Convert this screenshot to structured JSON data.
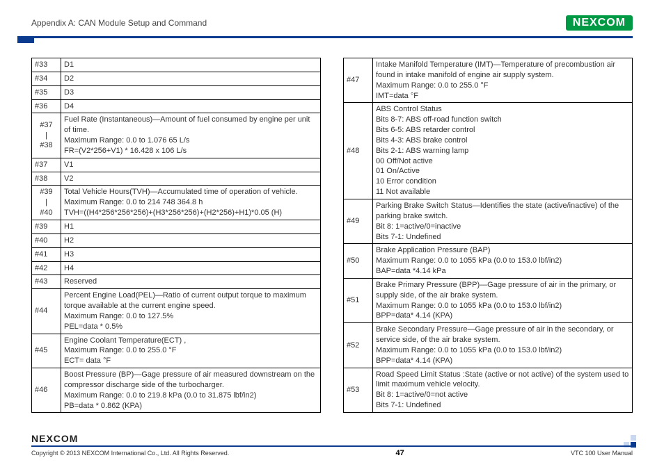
{
  "header": {
    "appendix": "Appendix A: CAN Module Setup and Command",
    "logo_text": "NEXCOM"
  },
  "left_rows": [
    {
      "idx": "#33",
      "desc": "D1"
    },
    {
      "idx": "#34",
      "desc": "D2"
    },
    {
      "idx": "#35",
      "desc": "D3"
    },
    {
      "idx": "#36",
      "desc": "D4"
    },
    {
      "idx": "#37\n|\n#38",
      "desc": "Fuel Rate (Instantaneous)—Amount of fuel consumed by engine per unit of time.\nMaximum Range: 0.0 to 1.076 65 L/s\nFR=(V2*256+V1) * 16.428 x 106 L/s"
    },
    {
      "idx": "#37",
      "desc": "V1"
    },
    {
      "idx": "#38",
      "desc": "V2"
    },
    {
      "idx": "#39\n|\n#40",
      "desc": "Total Vehicle Hours(TVH)—Accumulated time of operation of vehicle.\nMaximum Range: 0.0 to 214 748 364.8 h\nTVH=((H4*256*256*256)+(H3*256*256)+(H2*256)+H1)*0.05 (H)"
    },
    {
      "idx": "#39",
      "desc": "H1"
    },
    {
      "idx": "#40",
      "desc": "H2"
    },
    {
      "idx": "#41",
      "desc": "H3"
    },
    {
      "idx": "#42",
      "desc": "H4"
    },
    {
      "idx": "#43",
      "desc": "Reserved"
    },
    {
      "idx": "#44",
      "desc": "Percent Engine Load(PEL)—Ratio of current output torque to maximum torque available at the current engine speed.\nMaximum Range: 0.0 to 127.5%\nPEL=data * 0.5%"
    },
    {
      "idx": "#45",
      "desc": "Engine Coolant Temperature(ECT) ,\nMaximum Range: 0.0 to 255.0 °F\nECT= data °F"
    },
    {
      "idx": "#46",
      "desc": "Boost Pressure (BP)—Gage pressure of air measured downstream on the compressor discharge side of the turbocharger.\nMaximum Range: 0.0 to 219.8 kPa (0.0 to 31.875 lbf/in2)\nPB=data * 0.862 (KPA)"
    }
  ],
  "right_rows": [
    {
      "idx": "#47",
      "desc": "Intake Manifold Temperature (IMT)—Temperature of precombustion air found in intake manifold of engine air supply system.\nMaximum Range: 0.0 to 255.0 °F\nIMT=data °F"
    },
    {
      "idx": "#48",
      "desc": "ABS Control Status\nBits 8-7: ABS off-road function switch\nBits 6-5: ABS retarder control\nBits 4-3: ABS brake control\nBits 2-1: ABS warning lamp\n00 Off/Not active\n01 On/Active\n10 Error condition\n11 Not available"
    },
    {
      "idx": "#49",
      "desc": "Parking Brake Switch Status—Identifies the state (active/inactive) of the parking brake switch.\nBit 8: 1=active/0=inactive\nBits 7-1: Undefined"
    },
    {
      "idx": "#50",
      "desc": "Brake Application Pressure (BAP)\nMaximum Range: 0.0 to 1055 kPa (0.0 to 153.0 lbf/in2)\nBAP=data *4.14 kPa"
    },
    {
      "idx": "#51",
      "desc": "Brake Primary Pressure (BPP)—Gage pressure of air in the primary, or supply side, of the air brake system.\nMaximum Range: 0.0 to 1055 kPa (0.0 to 153.0 lbf/in2)\nBPP=data* 4.14 (KPA)"
    },
    {
      "idx": "#52",
      "desc": "Brake Secondary Pressure—Gage pressure of air in the secondary, or service side, of the air brake system.\nMaximum Range: 0.0 to 1055 kPa (0.0 to 153.0 lbf/in2)\nBPP=data* 4.14 (KPA)"
    },
    {
      "idx": "#53",
      "desc": "Road Speed Limit Status :State (active or not active) of the system used to limit maximum vehicle velocity.\nBit 8: 1=active/0=not active\nBits 7-1: Undefined"
    }
  ],
  "footer": {
    "logo": "NEXCOM",
    "copyright": "Copyright © 2013 NEXCOM International Co., Ltd. All Rights Reserved.",
    "page": "47",
    "manual": "VTC 100 User Manual"
  }
}
